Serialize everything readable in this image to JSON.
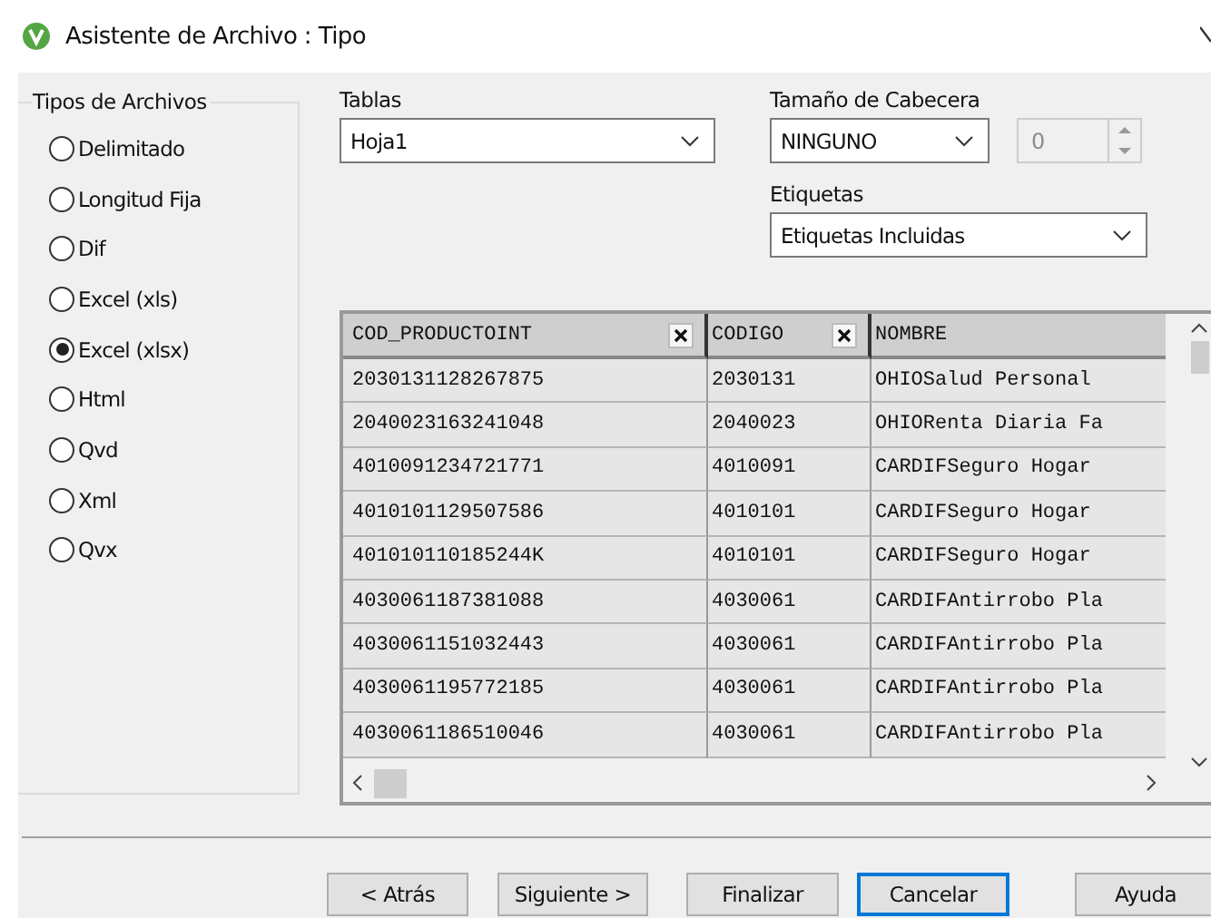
{
  "window": {
    "title": "Asistente de Archivo : Tipo"
  },
  "file_types": {
    "legend": "Tipos de Archivos",
    "options": [
      {
        "label": "Delimitado",
        "selected": false
      },
      {
        "label": "Longitud Fija",
        "selected": false
      },
      {
        "label": "Dif",
        "selected": false
      },
      {
        "label": "Excel (xls)",
        "selected": false
      },
      {
        "label": "Excel (xlsx)",
        "selected": true
      },
      {
        "label": "Html",
        "selected": false
      },
      {
        "label": "Qvd",
        "selected": false
      },
      {
        "label": "Xml",
        "selected": false
      },
      {
        "label": "Qvx",
        "selected": false
      }
    ]
  },
  "tables": {
    "label": "Tablas",
    "value": "Hoja1"
  },
  "header_size": {
    "label": "Tamaño de Cabecera",
    "value": "NINGUNO",
    "spinner_value": "0",
    "spinner_disabled": true
  },
  "labels": {
    "label": "Etiquetas",
    "value": "Etiquetas Incluidas"
  },
  "table": {
    "columns": [
      "COD_PRODUCTOINT",
      "CODIGO",
      "NOMBRE"
    ],
    "rows": [
      [
        "2030131128267875",
        "2030131",
        "OHIOSalud Personal"
      ],
      [
        "2040023163241048",
        "2040023",
        "OHIORenta Diaria Fa"
      ],
      [
        "4010091234721771",
        "4010091",
        "CARDIFSeguro Hogar"
      ],
      [
        "4010101129507586",
        "4010101",
        "CARDIFSeguro Hogar"
      ],
      [
        "401010110185244K",
        "4010101",
        "CARDIFSeguro Hogar"
      ],
      [
        "4030061187381088",
        "4030061",
        "CARDIFAntirrobo Pla"
      ],
      [
        "4030061151032443",
        "4030061",
        "CARDIFAntirrobo Pla"
      ],
      [
        "4030061195772185",
        "4030061",
        "CARDIFAntirrobo Pla"
      ],
      [
        "4030061186510046",
        "4030061",
        "CARDIFAntirrobo Pla"
      ]
    ]
  },
  "buttons": [
    {
      "label": "< Atrás",
      "focused": false
    },
    {
      "label": "Siguiente >",
      "focused": false
    },
    {
      "label": "Finalizar",
      "focused": false
    },
    {
      "label": "Cancelar",
      "focused": true
    },
    {
      "label": "Ayuda",
      "focused": false
    }
  ]
}
